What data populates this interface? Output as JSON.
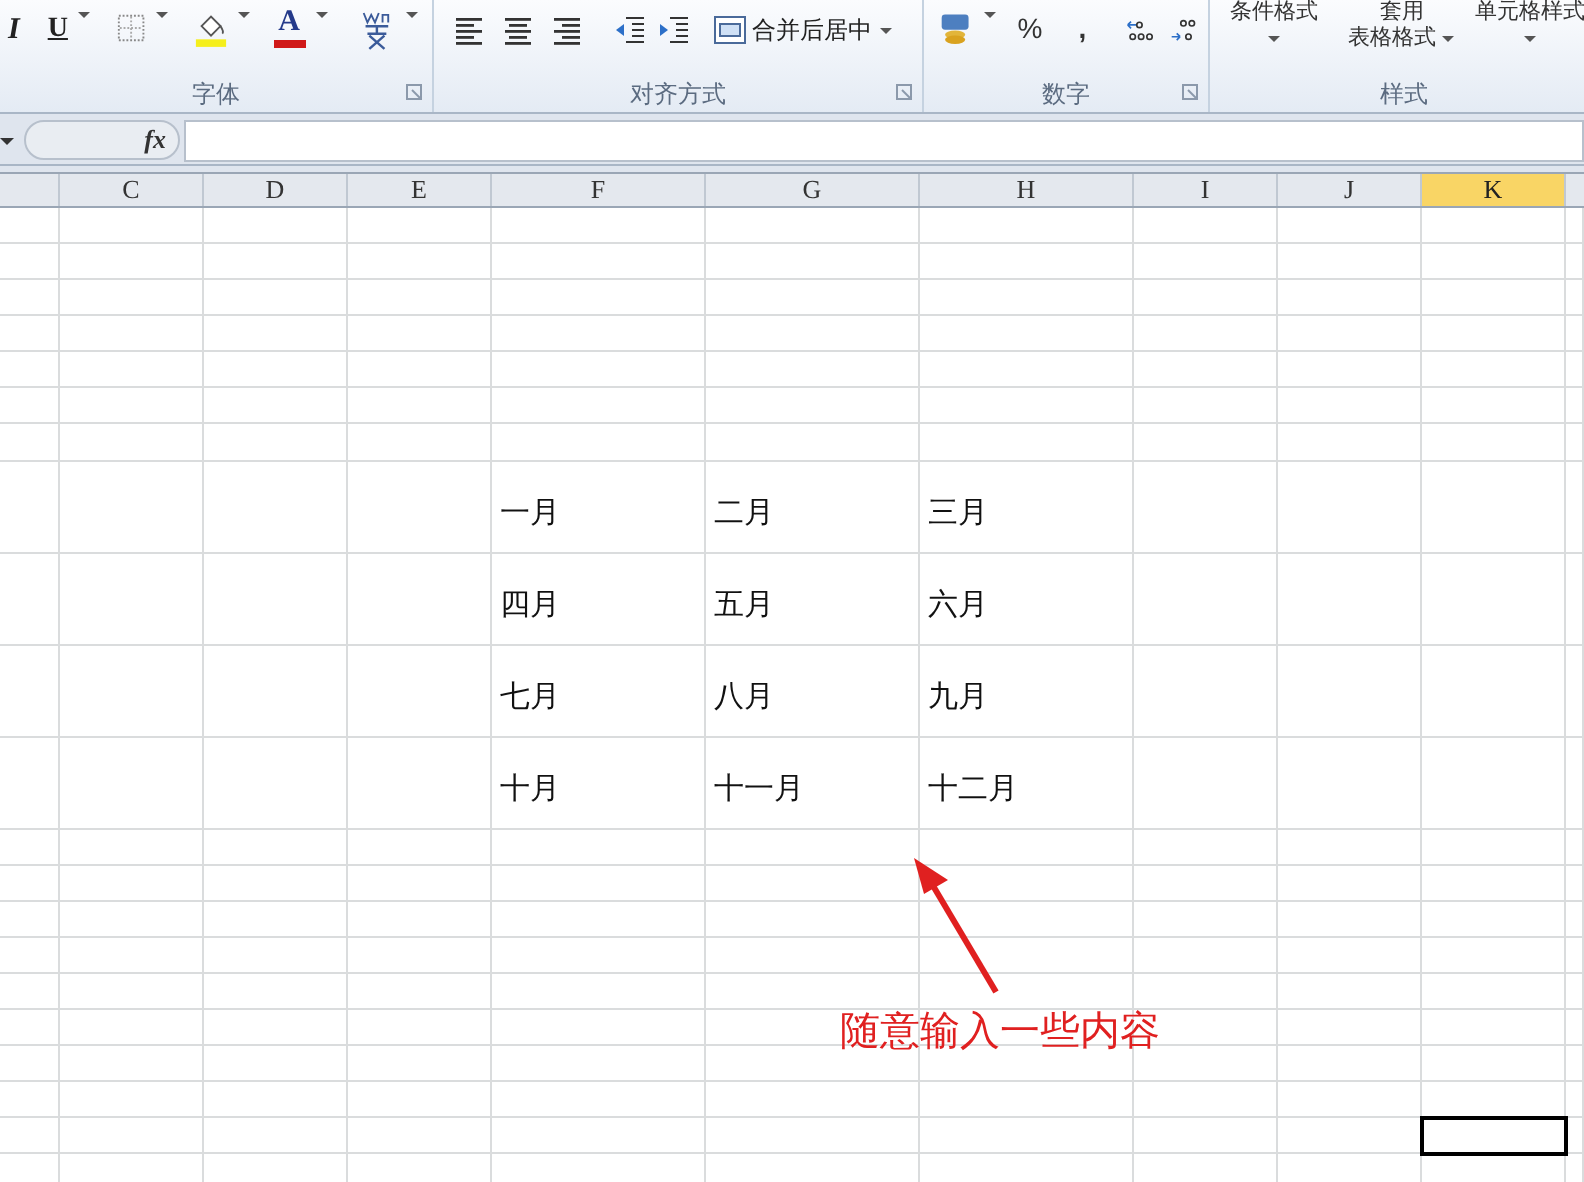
{
  "ribbon": {
    "groups": [
      {
        "label": "字体"
      },
      {
        "label": "对齐方式"
      },
      {
        "label": "数字"
      },
      {
        "label": "样式"
      }
    ],
    "font_buttons": [
      "I",
      "U",
      "A"
    ],
    "merge_button": "合并后居中",
    "number_buttons": [
      "%",
      ","
    ],
    "style_buttons": [
      {
        "lines": [
          "条件格式"
        ]
      },
      {
        "lines": [
          "套用",
          "表格格式"
        ]
      },
      {
        "lines": [
          "单元格样式"
        ]
      }
    ]
  },
  "formula_bar": {
    "fx": "fx"
  },
  "columns": [
    {
      "label": "C",
      "selected": false
    },
    {
      "label": "D",
      "selected": false
    },
    {
      "label": "E",
      "selected": false
    },
    {
      "label": "F",
      "selected": false
    },
    {
      "label": "G",
      "selected": false
    },
    {
      "label": "H",
      "selected": false
    },
    {
      "label": "I",
      "selected": false
    },
    {
      "label": "J",
      "selected": false
    },
    {
      "label": "K",
      "selected": true
    }
  ],
  "data_rows": [
    [
      "一月",
      "二月",
      "三月"
    ],
    [
      "四月",
      "五月",
      "六月"
    ],
    [
      "七月",
      "八月",
      "九月"
    ],
    [
      "十月",
      "十一月",
      "十二月"
    ]
  ],
  "annotation": "随意输入一些内容"
}
